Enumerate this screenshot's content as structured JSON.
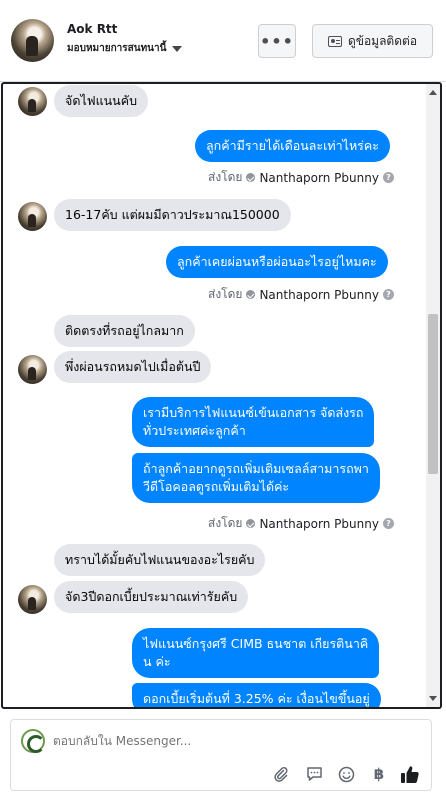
{
  "header": {
    "name": "Aok Rtt",
    "subtitle": "มอบหมายการสนทนานี้",
    "more_label": "•••",
    "contact_label": "ดูข้อมูลติดต่อ"
  },
  "messages": [
    {
      "text": "จัดไฟแนนคับ"
    },
    {
      "text": "ลูกค้ามีรายได้เดือนละเท่าไหร่คะ"
    },
    {
      "text": "16-17คับ แต่ผมมีดาวประมาณ150000"
    },
    {
      "text": "ลูกค้าเคยผ่อนหรือผ่อนอะไรอยู่ไหมคะ"
    },
    {
      "text": "ติดตรงที่รถอยู่ไกลมาก"
    },
    {
      "text": "พึ่งผ่อนรถหมดไปเมื่อต้นปี"
    },
    {
      "line1": "เรามีบริการไฟแนนซ์เข้นเอกสาร จัดส่งรถ",
      "line2": "ทั่วประเทศค่ะลูกค้า"
    },
    {
      "line1": "ถ้าลูกค้าอยากดูรถเพิ่มเติมเซลล์สามารถพา",
      "line2": "วีดีโอคอลดูรถเพิ่มเติมได้ค่ะ"
    },
    {
      "text": "ทราบได้มั้ยคับไฟแนนของอะไรยคับ"
    },
    {
      "text": "จัด3ปีดอกเบี้ยประมาณเท่ารัยคับ"
    },
    {
      "line1": "ไฟแนนซ์กรุงศรี CIMB ธนชาต เกียรตินาคิ",
      "line2": "น ค่ะ"
    },
    {
      "line1": "ดอกเบี้ยเริ่มต้นที่ 3.25% ค่ะ เงื่อนไขขึ้นอยู่",
      "line2": ""
    }
  ],
  "sent_by": {
    "prefix": "ส่งโดย",
    "agent": "Nanthaporn Pbunny",
    "help": "?"
  },
  "composer": {
    "placeholder": "ตอบกลับใน Messenger..."
  },
  "icons": {
    "attach": "paperclip-icon",
    "quick_reply": "chat-bubble-icon",
    "emoji": "smiley-icon",
    "payment": "baht-icon",
    "like": "thumbs-up-icon"
  },
  "colors": {
    "outgoing_bubble": "#0084ff",
    "incoming_bubble": "#e4e6eb",
    "like_icon": "#0084ff"
  }
}
